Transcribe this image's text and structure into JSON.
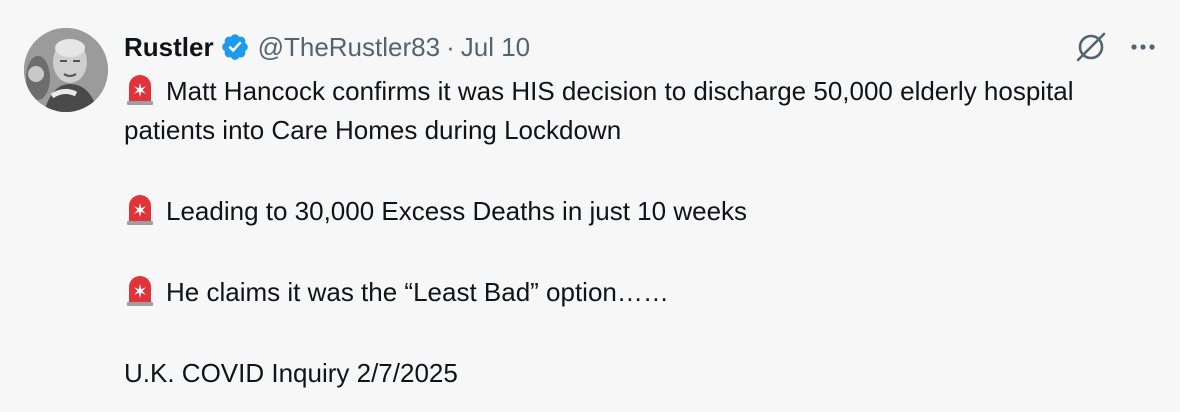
{
  "author": {
    "name": "Rustler",
    "handle": "@TheRustler83",
    "separator": "·",
    "date": "Jul 10",
    "verified": true,
    "avatar_icon": "profile-photo"
  },
  "actions": {
    "grok_icon": "slashed-circle-icon",
    "more_icon": "more-icon"
  },
  "colors": {
    "verified_badge": "#1d9bf0",
    "text_primary": "#0f1419",
    "text_secondary": "#536471",
    "background": "#f7f7f7",
    "siren_red": "#e0343a"
  },
  "tweet": {
    "line1": "Matt Hancock confirms it was HIS decision to discharge 50,000 elderly hospital patients into Care Homes during Lockdown",
    "line2": "Leading to 30,000 Excess Deaths in just 10 weeks",
    "line3": "He claims it was the “Least Bad” option……",
    "line4": "U.K. COVID Inquiry 2/7/2025",
    "emoji_icon": "police-siren-icon"
  }
}
